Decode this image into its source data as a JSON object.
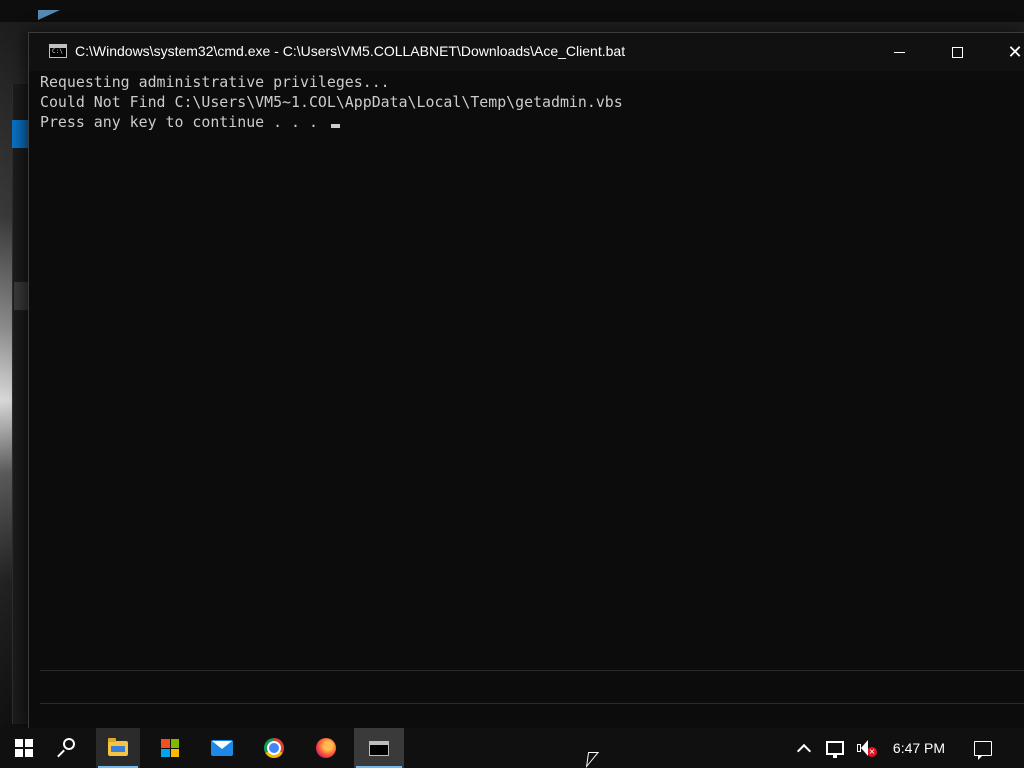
{
  "window": {
    "title": "C:\\Windows\\system32\\cmd.exe - C:\\Users\\VM5.COLLABNET\\Downloads\\Ace_Client.bat",
    "icon_label": "C:\\",
    "minimize_glyph": "",
    "close_glyph": "✕"
  },
  "console": {
    "lines": [
      "Requesting administrative privileges...",
      "Could Not Find C:\\Users\\VM5~1.COL\\AppData\\Local\\Temp\\getadmin.vbs",
      "Press any key to continue . . . "
    ]
  },
  "taskbar": {
    "items": [
      {
        "name": "start",
        "icon": "windows-logo-icon"
      },
      {
        "name": "search",
        "icon": "search-icon"
      },
      {
        "name": "file-explorer",
        "icon": "folder-icon",
        "running": true
      },
      {
        "name": "microsoft-store",
        "icon": "store-icon"
      },
      {
        "name": "mail",
        "icon": "mail-icon"
      },
      {
        "name": "chrome",
        "icon": "chrome-icon"
      },
      {
        "name": "firefox",
        "icon": "firefox-icon"
      },
      {
        "name": "command-prompt",
        "icon": "cmd-icon",
        "running": true,
        "active": true
      }
    ],
    "clock": "6:47 PM"
  },
  "colors": {
    "console_bg": "#0c0c0c",
    "console_text": "#cccccc",
    "taskbar_bg": "#101010",
    "active_indicator": "#76b9ed",
    "mute_badge": "#e81123"
  }
}
